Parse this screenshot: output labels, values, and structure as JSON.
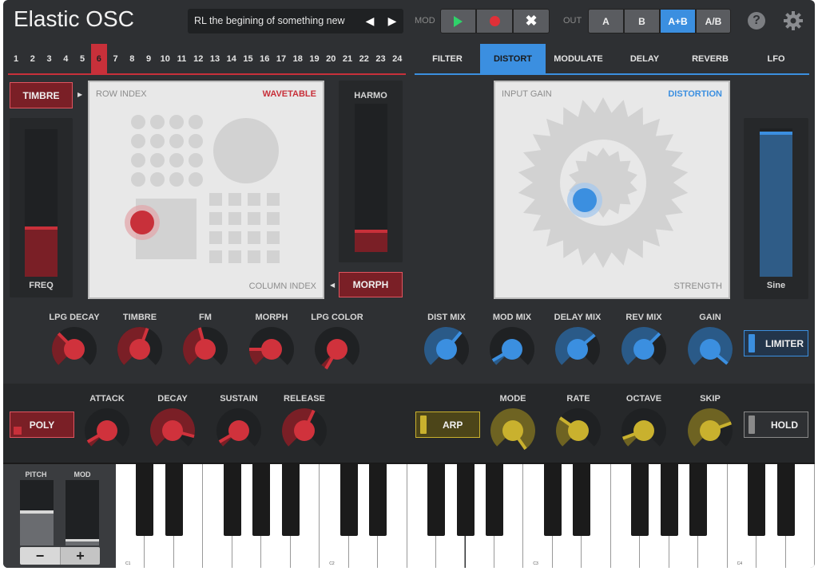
{
  "header": {
    "title": "Elastic OSC",
    "preset": "RL the begining of something new",
    "mod_label": "MOD",
    "out_label": "OUT",
    "out_options": [
      "A",
      "B",
      "A+B",
      "A/B"
    ],
    "out_selected": "A+B"
  },
  "row_numbers": [
    "1",
    "2",
    "3",
    "4",
    "5",
    "6",
    "7",
    "8",
    "9",
    "10",
    "11",
    "12",
    "13",
    "14",
    "15",
    "16",
    "17",
    "18",
    "19",
    "20",
    "21",
    "22",
    "23",
    "24"
  ],
  "row_selected": "6",
  "tabs": [
    "FILTER",
    "DISTORT",
    "MODULATE",
    "DELAY",
    "REVERB",
    "LFO"
  ],
  "tab_selected": "DISTORT",
  "osc": {
    "timbre_button": "TIMBRE",
    "freq_label": "FREQ",
    "pad_top_left": "ROW INDEX",
    "pad_top_right": "WAVETABLE",
    "pad_bottom_right": "COLUMN INDEX",
    "harmo_label": "HARMO",
    "morph_button": "MORPH",
    "freq_level": 0.34,
    "harmo_level": 0.12
  },
  "fx": {
    "pad_top_left": "INPUT GAIN",
    "pad_top_right": "DISTORTION",
    "pad_bottom_right": "STRENGTH",
    "sine_label": "Sine",
    "sine_level": 0.98
  },
  "knobs_red_top": [
    "LPG DECAY",
    "TIMBRE",
    "FM",
    "MORPH",
    "LPG COLOR"
  ],
  "knobs_blue": [
    "DIST MIX",
    "MOD MIX",
    "DELAY MIX",
    "REV MIX",
    "GAIN"
  ],
  "limiter_button": "LIMITER",
  "env": {
    "poly_button": "POLY",
    "knobs": [
      "ATTACK",
      "DECAY",
      "SUSTAIN",
      "RELEASE"
    ]
  },
  "arp": {
    "arp_button": "ARP",
    "knobs": [
      "MODE",
      "RATE",
      "OCTAVE",
      "SKIP"
    ],
    "hold_button": "HOLD"
  },
  "keyboard": {
    "pitch_label": "PITCH",
    "mod_label": "MOD",
    "minus": "−",
    "plus": "+",
    "octaves": [
      "C1",
      "C2",
      "C3",
      "C4"
    ]
  },
  "colors": {
    "red": "#c8303a",
    "blue": "#3b8fe0",
    "yellow": "#c9b12e",
    "panel": "#2e3033"
  }
}
